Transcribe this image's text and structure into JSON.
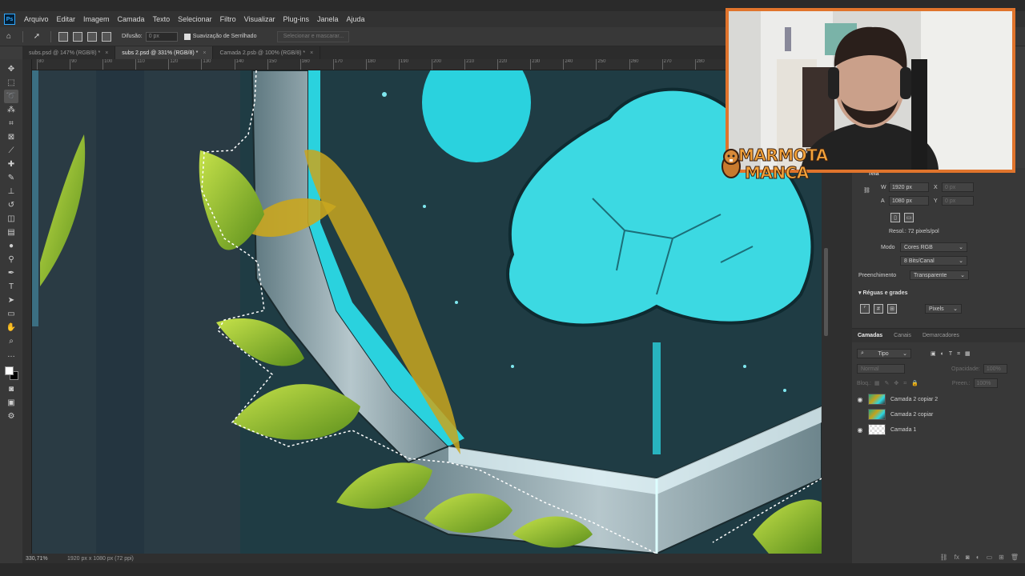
{
  "app": {
    "name": "Ps"
  },
  "menu": [
    "Arquivo",
    "Editar",
    "Imagem",
    "Camada",
    "Texto",
    "Selecionar",
    "Filtro",
    "Visualizar",
    "Plug-ins",
    "Janela",
    "Ajuda"
  ],
  "options_bar": {
    "feather_label": "Difusão:",
    "feather_value": "0 px",
    "antialias_label": "Suavização de Serrilhado",
    "select_mask_label": "Selecionar e mascarar..."
  },
  "tabs": [
    {
      "label": "subs.psd @ 147% (RGB/8) *",
      "active": false
    },
    {
      "label": "subs 2.psd @ 331% (RGB/8) *",
      "active": true
    },
    {
      "label": "Camada 2.psb @ 100% (RGB/8) *",
      "active": false
    }
  ],
  "ruler_ticks": [
    "80",
    "90",
    "100",
    "110",
    "120",
    "130",
    "140",
    "150",
    "160",
    "170",
    "180",
    "190",
    "200",
    "210",
    "220",
    "230",
    "240",
    "250",
    "260",
    "270",
    "280",
    "290",
    "300",
    "310"
  ],
  "status": {
    "zoom": "330,71%",
    "doc_info": "1920 px x 1080 px (72 ppi)"
  },
  "properties": {
    "title": "Tela",
    "width_label": "W",
    "width_value": "1920 px",
    "height_label": "A",
    "height_value": "1080 px",
    "x_label": "X",
    "x_value": "0 px",
    "y_label": "Y",
    "y_value": "0 px",
    "resolution": "Resol.: 72 pixels/pol",
    "mode_label": "Modo",
    "mode_value": "Cores RGB",
    "bit_depth": "8 Bits/Canal",
    "fill_label": "Preenchimento",
    "fill_value": "Transparente",
    "rulers_section": "Réguas e grades",
    "units_value": "Pixels"
  },
  "layers_panel": {
    "tabs": [
      "Camadas",
      "Canais",
      "Demarcadores"
    ],
    "filter_label": "Tipo",
    "blend_mode": "Normal",
    "opacity_label": "Opacidade:",
    "opacity_value": "100%",
    "lock_label": "Bloq.:",
    "fill_label": "Preen.:",
    "fill_value": "100%",
    "layers": [
      {
        "name": "Camada 2 copiar 2",
        "visible": true,
        "thumb": "art"
      },
      {
        "name": "Camada 2 copiar",
        "visible": false,
        "thumb": "art"
      },
      {
        "name": "Camada 1",
        "visible": true,
        "thumb": "blank"
      }
    ]
  },
  "overlay": {
    "logo_line1": "MARMOTA",
    "logo_line2": "MANCA"
  },
  "colors": {
    "accent_orange": "#e0742c",
    "canvas_teal": "#2bd6e2",
    "canvas_dark": "#1e3940",
    "leaf_green": "#8fc43a",
    "leaf_yellow": "#c9a61f"
  }
}
